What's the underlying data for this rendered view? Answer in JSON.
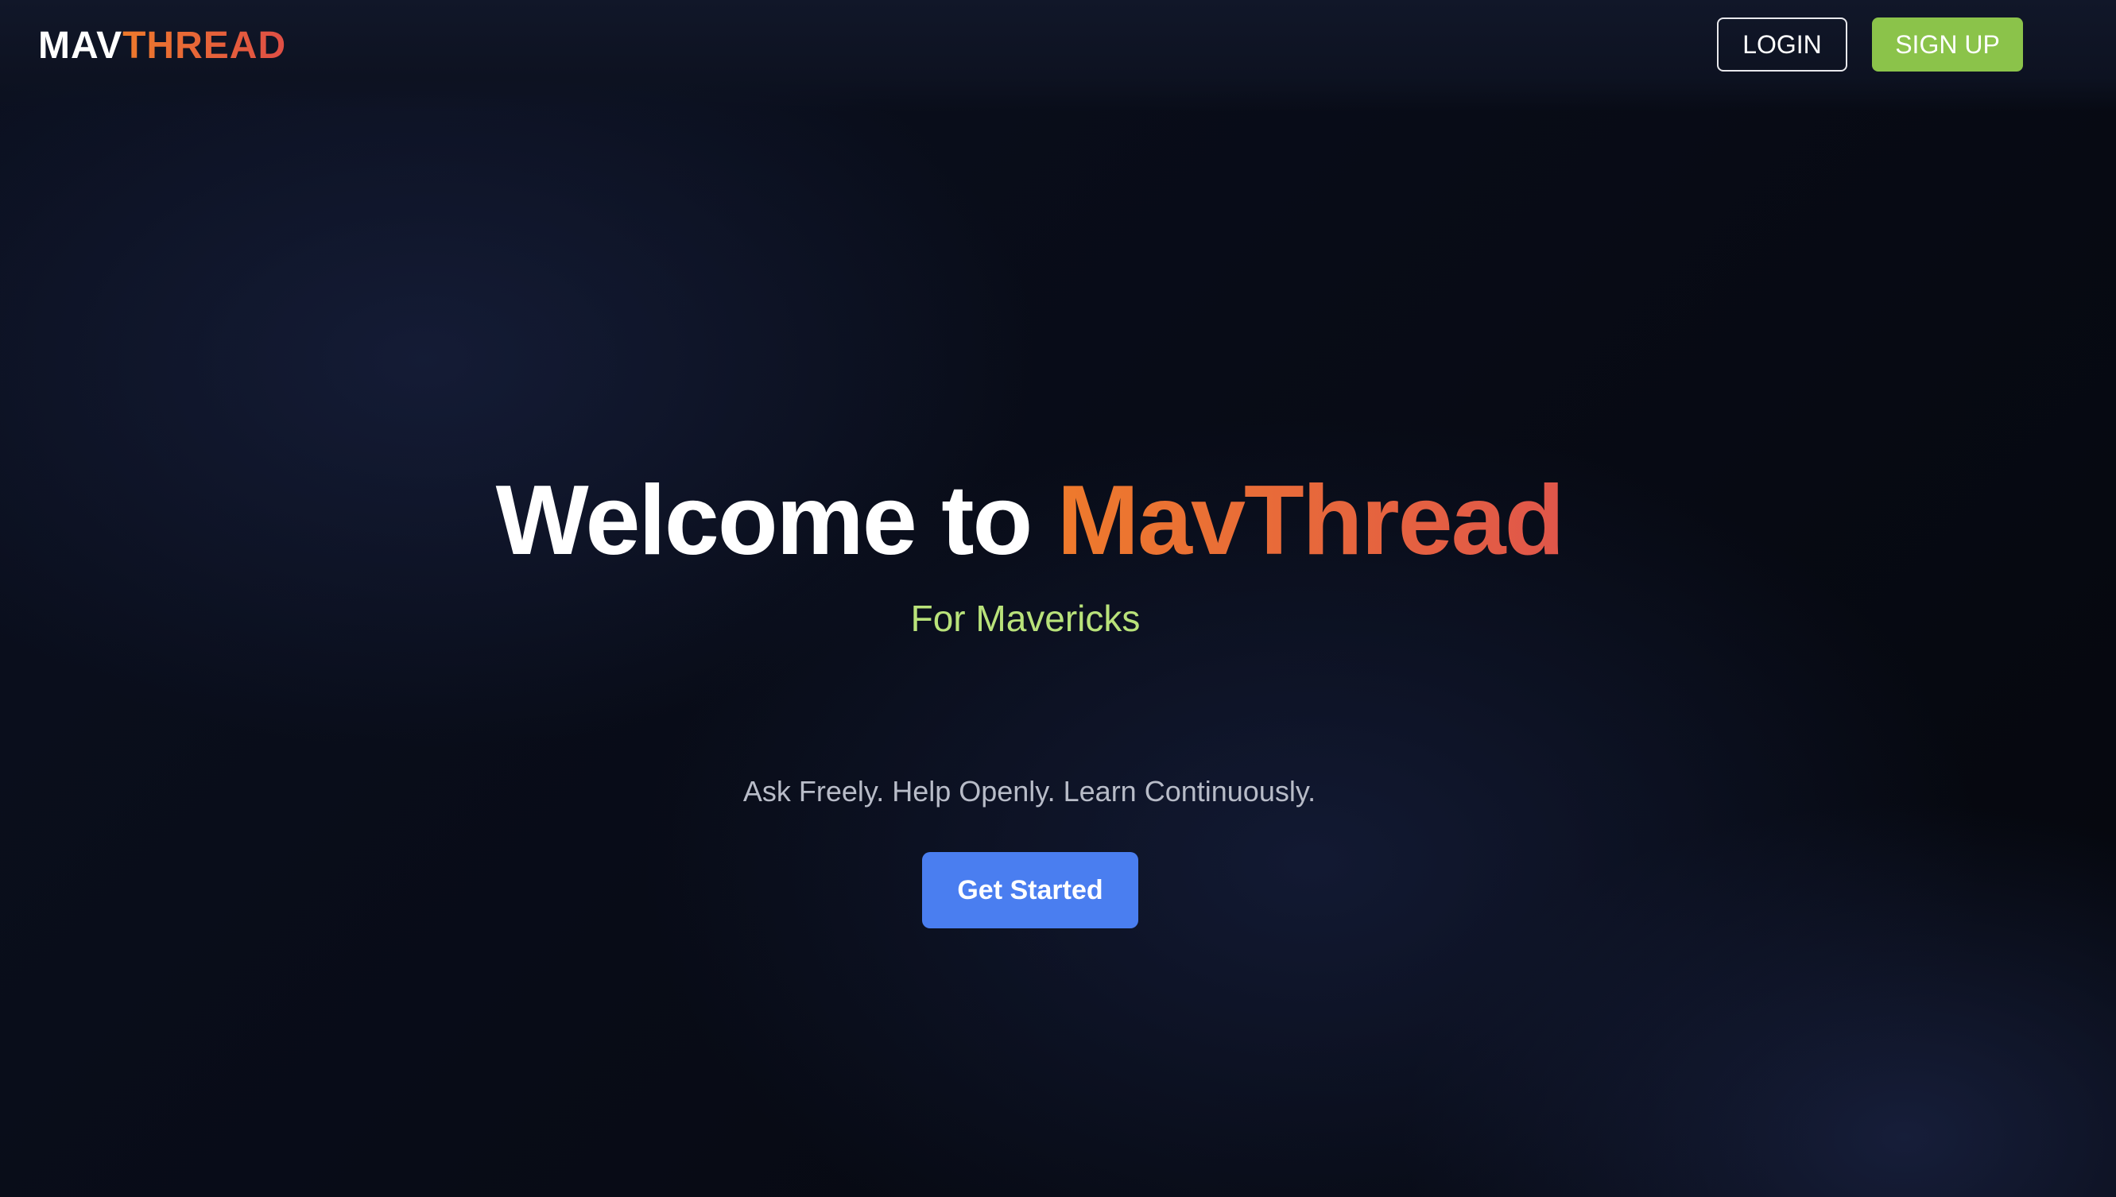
{
  "header": {
    "logo_part1": "MAV",
    "logo_part2": "THREAD",
    "login_label": "LOGIN",
    "signup_label": "SIGN UP"
  },
  "hero": {
    "title_part1": "Welcome to ",
    "title_part2": "MavThread",
    "subtitle": "For Mavericks",
    "tagline": "Ask Freely. Help Openly. Learn Continuously.",
    "cta_label": "Get Started"
  },
  "colors": {
    "background": "#0b1020",
    "brand_orange": "#ee7a2c",
    "brand_red": "#df4e45",
    "signup_green": "#8bc34a",
    "subtitle_green": "#b9e27a",
    "cta_blue": "#4a7ef0"
  }
}
